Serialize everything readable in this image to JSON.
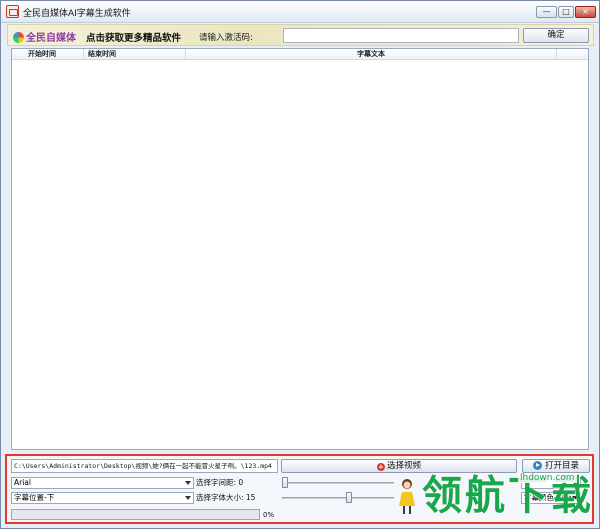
{
  "window": {
    "title": "全民自媒体AI字幕生成软件",
    "controls": {
      "minimize": "—",
      "maximize": "□",
      "close": "×"
    }
  },
  "header": {
    "logo_text": "全民自媒体",
    "promo_link": "点击获取更多精品软件",
    "code_label": "请输入激活码:",
    "code_value": "",
    "confirm_label": "确定"
  },
  "table": {
    "columns": [
      "开始时间",
      "结束时间",
      "字幕文本"
    ],
    "rows": []
  },
  "controls": {
    "video_path": "C:\\Users\\Administrator\\Desktop\\视频\\她?俩在一起不能冒火星子咧。\\123.mp4",
    "select_video_label": "选择视频",
    "open_dir_label": "打开目录",
    "font_value": "Arial",
    "position_value": "字幕位置-下",
    "spacing_label": "选择字间距: 0",
    "fontsize_label": "选择字体大小: 15",
    "spacing_value": 0,
    "fontsize_value": 15,
    "fontsize_fraction": 0.6,
    "card_value": "卡",
    "color_value": "字幕颜色-黑色",
    "progress_percent": 0,
    "progress_label": "0%"
  },
  "watermark": {
    "text": "领航下载",
    "url": "lhdown.com"
  },
  "colors": {
    "accent_red": "#e23b2e",
    "watermark_green": "#1aa64a"
  }
}
